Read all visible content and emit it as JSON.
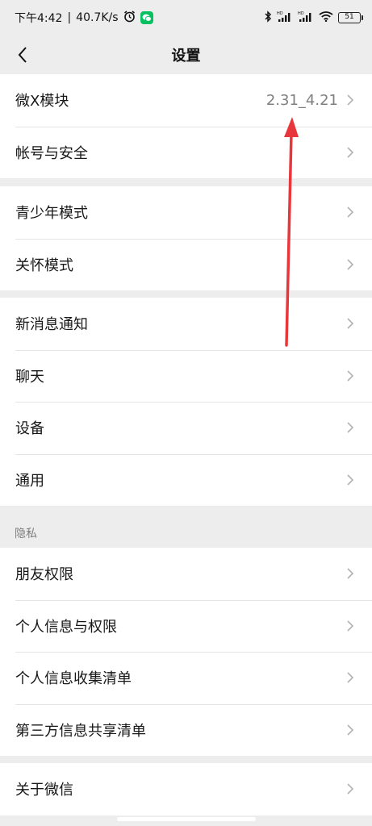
{
  "status_bar": {
    "time": "下午4:42",
    "separator": "|",
    "speed": "40.7K/s",
    "battery": "51",
    "icons": [
      "alarm-icon",
      "wechat-icon",
      "bluetooth-icon",
      "hd-signal-icon",
      "hd-signal-icon",
      "wifi-icon",
      "battery-icon"
    ]
  },
  "nav": {
    "title": "设置"
  },
  "groups": {
    "g1": [
      {
        "label": "微X模块",
        "value": "2.31_4.21"
      },
      {
        "label": "帐号与安全"
      }
    ],
    "g2": [
      {
        "label": "青少年模式"
      },
      {
        "label": "关怀模式"
      }
    ],
    "g3": [
      {
        "label": "新消息通知"
      },
      {
        "label": "聊天"
      },
      {
        "label": "设备"
      },
      {
        "label": "通用"
      }
    ],
    "privacy_header": "隐私",
    "g4": [
      {
        "label": "朋友权限"
      },
      {
        "label": "个人信息与权限"
      },
      {
        "label": "个人信息收集清单"
      },
      {
        "label": "第三方信息共享清单"
      }
    ],
    "g5": [
      {
        "label": "关于微信"
      }
    ]
  },
  "colors": {
    "background": "#ededed",
    "row": "#ffffff",
    "annotation_arrow": "#e8373c",
    "wechat_green": "#07c160"
  }
}
